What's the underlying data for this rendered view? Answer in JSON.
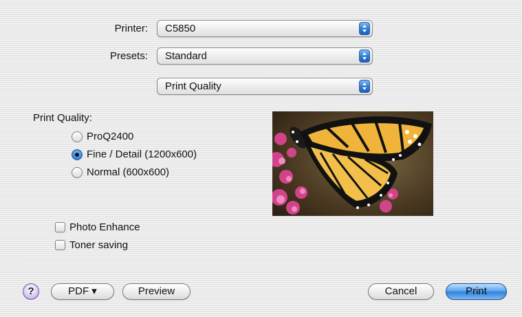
{
  "printer": {
    "label": "Printer:",
    "value": "C5850"
  },
  "presets": {
    "label": "Presets:",
    "value": "Standard"
  },
  "panel": {
    "value": "Print Quality"
  },
  "quality": {
    "heading": "Print Quality:",
    "options": [
      "ProQ2400",
      "Fine / Detail (1200x600)",
      "Normal (600x600)"
    ],
    "selected": "Fine / Detail (1200x600)"
  },
  "checkboxes": {
    "photo_enhance": "Photo Enhance",
    "toner_saving": "Toner saving"
  },
  "buttons": {
    "help": "?",
    "pdf": "PDF ▾",
    "preview": "Preview",
    "cancel": "Cancel",
    "print": "Print"
  },
  "icons": [
    "chevron-updown-icon",
    "help-icon",
    "butterfly-preview-image"
  ],
  "colors": {
    "accent": "#2f7fd9",
    "help": "#a996dc"
  }
}
